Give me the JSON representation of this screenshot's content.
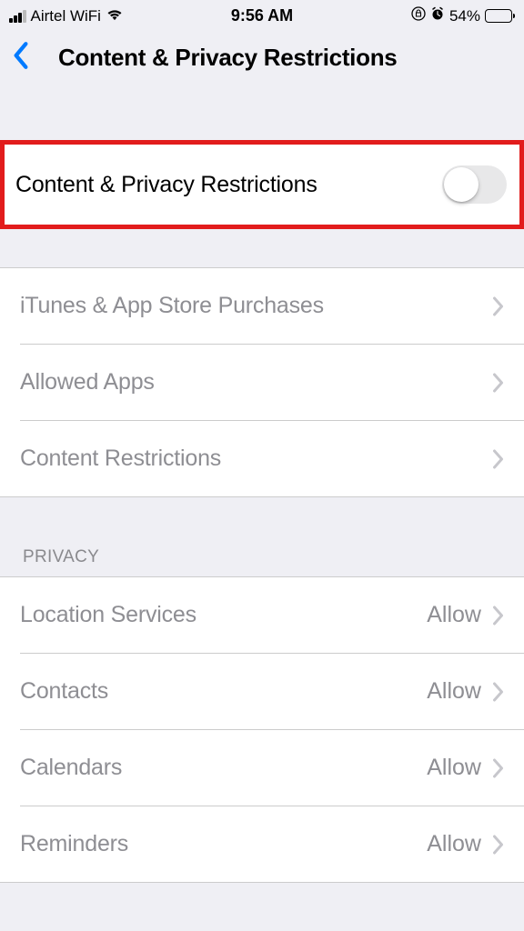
{
  "statusBar": {
    "carrier": "Airtel WiFi",
    "time": "9:56 AM",
    "batteryPercent": "54%"
  },
  "navBar": {
    "title": "Content & Privacy Restrictions"
  },
  "mainToggle": {
    "label": "Content & Privacy Restrictions",
    "enabled": false
  },
  "firstSection": {
    "items": [
      {
        "label": "iTunes & App Store Purchases"
      },
      {
        "label": "Allowed Apps"
      },
      {
        "label": "Content Restrictions"
      }
    ]
  },
  "privacySection": {
    "header": "PRIVACY",
    "items": [
      {
        "label": "Location Services",
        "value": "Allow"
      },
      {
        "label": "Contacts",
        "value": "Allow"
      },
      {
        "label": "Calendars",
        "value": "Allow"
      },
      {
        "label": "Reminders",
        "value": "Allow"
      }
    ]
  }
}
